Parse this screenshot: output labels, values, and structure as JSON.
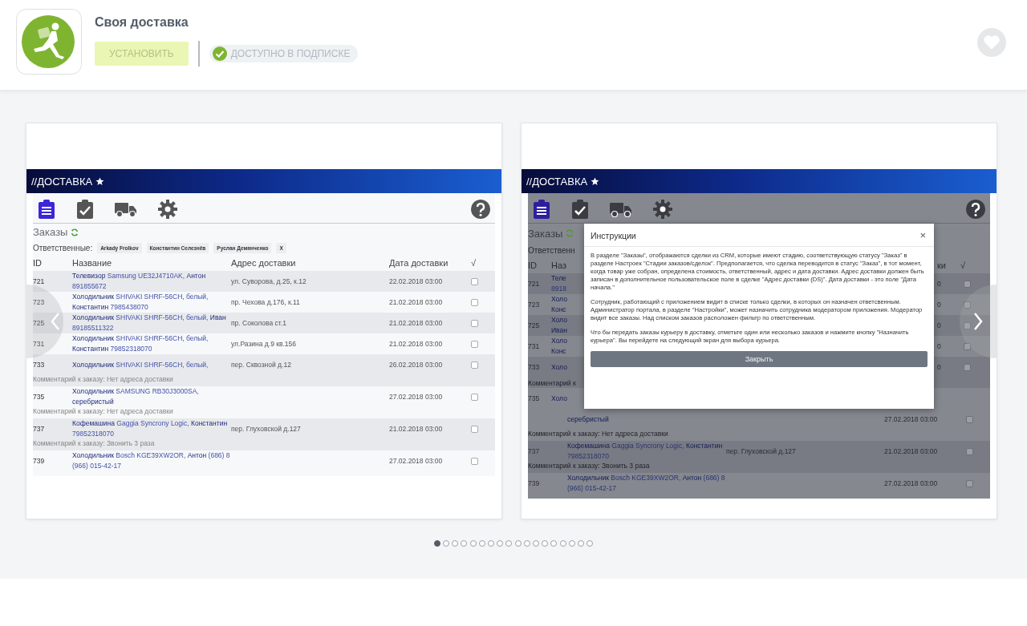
{
  "app": {
    "title": "Своя доставка",
    "install_button": {
      "label": "УСТАНОВИТЬ",
      "disabled": true
    },
    "subscription_badge": "ДОСТУПНО В ПОДПИСКЕ"
  },
  "slides": [
    {
      "kind": "list",
      "header_title": "//ДОСТАВКА",
      "toolbar": [
        {
          "kind": "orders",
          "selected": true
        },
        {
          "kind": "done",
          "selected": false
        },
        {
          "kind": "truck",
          "selected": false
        },
        {
          "kind": "settings",
          "selected": false
        }
      ],
      "section_title": "Заказы",
      "filter_label": "Ответственные:",
      "chips": [
        "Arkady Frolkov",
        "Константин Селезнёв",
        "Руслан Демянченко",
        "X"
      ],
      "columns": [
        "ID",
        "Название",
        "Адрес доставки",
        "Дата доставки",
        "√"
      ],
      "rows": [
        {
          "id": "721",
          "name": "**Телевизор** Samsung UE32J4710AK, **Антон** 891855672",
          "address": "ул. Суворова, д.25, к.12",
          "date": "22.02.2018 03:00",
          "checked": false
        },
        {
          "id": "723",
          "name": "**Холодильник** SHIVAKI SHRF-56CH, белый, **Константин** 7985438070",
          "address": "пр. Чехова д.176, к.11",
          "date": "21.02.2018 03:00",
          "checked": false
        },
        {
          "id": "725",
          "name": "**Холодильник** SHIVAKI SHRF-56CH, белый, **Иван** 89185511322",
          "address": "пр. Соколова ст.1",
          "date": "21.02.2018 03:00",
          "checked": false
        },
        {
          "id": "731",
          "name": "**Холодильник** SHIVAKI SHRF-56CH, белый, **Константин** 79852318070",
          "address": "ул.Разина д.9 кв.156",
          "date": "21.02.2018 03:00",
          "checked": false
        },
        {
          "id": "733",
          "name": "**Холодильник** SHIVAKI SHRF-56CH, белый,",
          "address": "пер. Сквозной д.12",
          "date": "26.02.2018 03:00",
          "checked": false,
          "comment": "Комментарий к заказу: Нет адреса доставки"
        },
        {
          "id": "735",
          "name": "**Холодильник** SAMSUNG RB30J3000SA, **серебристый**",
          "date": "27.02.2018 03:00",
          "checked": false,
          "comment": "Комментарий к заказу: Нет адреса доставки"
        },
        {
          "id": "737",
          "name": "**Кофемашина** Gaggia Syncrony Logic, **Константин** 79852318070",
          "address": "пер. Глуховской д.127",
          "date": "21.02.2018 03:00",
          "checked": false,
          "comment": "Комментарий к заказу: Звонить 3 раза"
        },
        {
          "id": "739",
          "name": "**Холодильник** Bosch KGE39XW2OR, **Антон** (686) 8 (966) 015-42-17",
          "date": "27.02.2018 03:00",
          "checked": false
        }
      ]
    },
    {
      "kind": "instructions",
      "header_title": "//ДОСТАВКА",
      "toolbar": [
        {
          "kind": "orders",
          "selected": true
        },
        {
          "kind": "done",
          "selected": false
        },
        {
          "kind": "truck",
          "selected": false
        },
        {
          "kind": "settings",
          "selected": false
        }
      ],
      "side_rows": [
        {
          "kind": "title",
          "text": "Заказы"
        },
        {
          "kind": "filter",
          "text": "Ответственн"
        },
        {
          "kind": "columns",
          "id": "ID",
          "name": "Наз",
          "date": "ки",
          "check": "√"
        },
        {
          "kind": "order",
          "id": "721",
          "lines": [
            "**Теле**",
            "8918"
          ],
          "date": "0",
          "checked": false
        },
        {
          "kind": "order",
          "id": "723",
          "lines": [
            "**Холо**",
            "**Конс**"
          ],
          "date": "0",
          "checked": false
        },
        {
          "kind": "order",
          "id": "725",
          "lines": [
            "**Холо**",
            "**Иван**"
          ],
          "date": "0",
          "checked": false
        },
        {
          "kind": "order",
          "id": "731",
          "lines": [
            "**Холо**",
            "**Конс**"
          ],
          "date": "0",
          "checked": false
        },
        {
          "kind": "order",
          "id": "733",
          "lines": [
            "**Холо**"
          ],
          "date": "0",
          "checked": false
        },
        {
          "kind": "comment",
          "text": "Комментарий к"
        },
        {
          "kind": "order",
          "id": "735",
          "lines": [
            "**Холо**"
          ]
        }
      ],
      "dialog": {
        "title": "Инструкции",
        "close": "×",
        "paragraphs": [
          "В разделе \"Заказы\", отображаются сделки из CRM, которые имеют стадию, соответствующую статусу \"Заказ\" в разделе Настроек \"Стадии заказов/сделок\". Предполагается, что сделка переводится в статус \"Заказ\", в тот момент, когда товар уже собран, определена стоимость, ответственный, адрес и дата доставки. Адрес доставки должен быть записан в дополнительное пользовательское поле в сделке \"Адрес доставки (DS)\". Дата доставки - это поле \"Дата начала.\"",
          "Сотрудник, работающий с приложением видит в списке только сделки, в которых он назначен ответсвенным. Администратор портала, в разделе \"Настройки\", может назначить сотрудника модератором приложения. Модератор видит все заказы. Над списком заказов расположен фильтр по ответственным.",
          "Что бы передать заказы курьеру в доставку, отметьте один или несколько заказов и нажмите кнопку \"Назначить курьера\". Вы перейдете на следующий экран для выбора курьера."
        ],
        "button": "Закрыть"
      },
      "bottom_rows": [
        {
          "name": "**серебристый**",
          "date": "27.02.2018 03:00",
          "checked": false,
          "comment": "Комментарий к заказу: Нет адреса доставки"
        },
        {
          "id": "737",
          "name": "**Кофемашина** Gaggia Syncrony Logic, **Константин** 79852318070",
          "address": "пер. Глуховской д.127",
          "date": "21.02.2018 03:00",
          "checked": false,
          "comment": "Комментарий к заказу: Звонить 3 раза"
        },
        {
          "id": "739",
          "name": "**Холодильник** Bosch KGE39XW2OR, **Антон** (686) 8 (966) 015-42-17",
          "date": "27.02.2018 03:00",
          "checked": false
        }
      ]
    }
  ],
  "carousel": {
    "dots": [
      {
        "selected": true
      },
      {
        "selected": false
      },
      {
        "selected": false
      },
      {
        "selected": false
      },
      {
        "selected": false
      },
      {
        "selected": false
      },
      {
        "selected": false
      },
      {
        "selected": false
      },
      {
        "selected": false
      },
      {
        "selected": false
      },
      {
        "selected": false
      },
      {
        "selected": false
      },
      {
        "selected": false
      },
      {
        "selected": false
      },
      {
        "selected": false
      },
      {
        "selected": false
      },
      {
        "selected": false
      },
      {
        "selected": false
      }
    ]
  }
}
